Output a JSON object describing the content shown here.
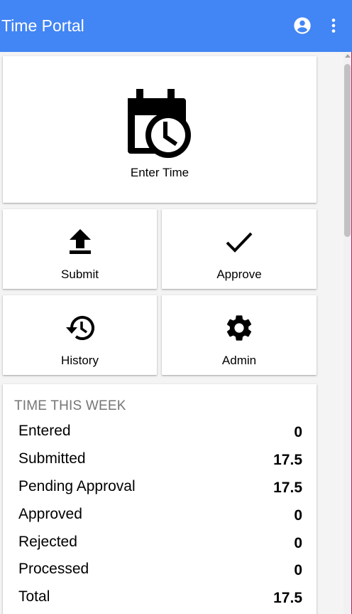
{
  "app": {
    "title": "Time Portal"
  },
  "header_icons": {
    "account": "account-circle-icon",
    "more": "more-vert-icon"
  },
  "colors": {
    "appbar": "#4285f4",
    "section_header": "#757575"
  },
  "tiles": {
    "enter_time": {
      "label": "Enter Time",
      "icon": "calendar-clock-icon"
    },
    "submit": {
      "label": "Submit",
      "icon": "upload-icon"
    },
    "approve": {
      "label": "Approve",
      "icon": "check-icon"
    },
    "history": {
      "label": "History",
      "icon": "history-icon"
    },
    "admin": {
      "label": "Admin",
      "icon": "gear-icon"
    }
  },
  "week": {
    "header": "TIME THIS WEEK",
    "rows": [
      {
        "label": "Entered",
        "value": "0"
      },
      {
        "label": "Submitted",
        "value": "17.5"
      },
      {
        "label": "Pending Approval",
        "value": "17.5"
      },
      {
        "label": "Approved",
        "value": "0"
      },
      {
        "label": "Rejected",
        "value": "0"
      },
      {
        "label": "Processed",
        "value": "0"
      },
      {
        "label": "Total",
        "value": "17.5"
      }
    ]
  }
}
